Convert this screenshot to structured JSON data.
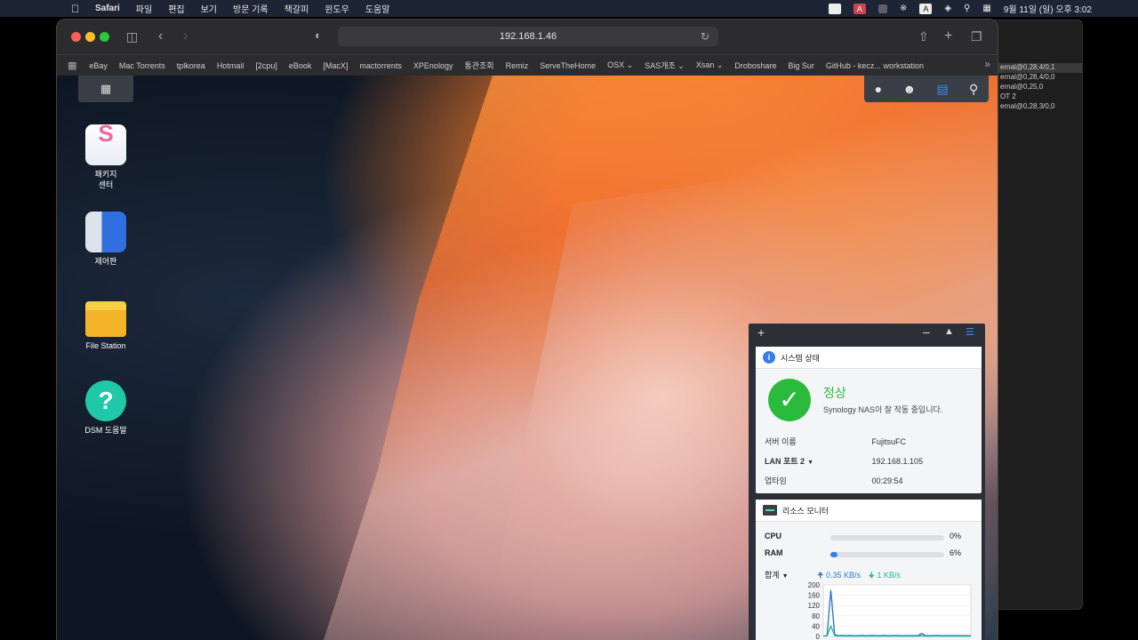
{
  "menubar": {
    "apple": "",
    "app": "Safari",
    "items": [
      "파일",
      "편집",
      "보기",
      "방문 기록",
      "책갈피",
      "윈도우",
      "도움말"
    ],
    "tray_a": "A",
    "tray_a2": "A",
    "clock": "9월 11일 (일) 오후 3:02"
  },
  "background_window": {
    "rows": [
      "ernal@0,28,4/0,1",
      "ernal@0,28,4/0,0",
      "ernal@0,25,0",
      "OT 2",
      "ernal@0,28,3/0,0"
    ]
  },
  "safari": {
    "address": "192.168.1.46",
    "favorites": [
      "eBay",
      "Mac Torrents",
      "tplkorea",
      "Hotmail",
      "[2cpu]",
      "eBook",
      "[MacX]",
      "mactorrents",
      "XPEnology",
      "통관조회",
      "Remiz",
      "ServeTheHome",
      "OSX ⌄",
      "SAS개조 ⌄",
      "Xsan ⌄",
      "Droboshare",
      "Big Sur",
      "GitHub - kecz... workstation"
    ]
  },
  "desktop": {
    "icons": [
      {
        "label": "패키지\n센터"
      },
      {
        "label": "제어판"
      },
      {
        "label": "File Station"
      },
      {
        "label": "DSM 도움말"
      }
    ],
    "help_glyph": "?"
  },
  "widget": {
    "system": {
      "title": "시스템 상태",
      "status": "정상",
      "desc": "Synology NAS이 잘 작동 중입니다.",
      "server_label": "서버 이름",
      "server_value": "FujitsuFC",
      "lan_label": "LAN 포트 2",
      "lan_value": "192.168.1.105",
      "uptime_label": "업타임",
      "uptime_value": "00:29:54"
    },
    "resource": {
      "title": "리소스 모니터",
      "cpu_label": "CPU",
      "cpu_pct": "0%",
      "cpu_value": 0,
      "ram_label": "RAM",
      "ram_pct": "6%",
      "ram_value": 6,
      "total_label": "합계",
      "up": "0.35 KB/s",
      "down": "1 KB/s"
    }
  },
  "chart_data": {
    "type": "line",
    "ylim": [
      0,
      200
    ],
    "yticks": [
      200,
      160,
      120,
      80,
      40,
      0
    ],
    "x": [
      0,
      1,
      2,
      3,
      4,
      5,
      6,
      7,
      8,
      9,
      10,
      11,
      12,
      13,
      14,
      15,
      16,
      17,
      18,
      19,
      20,
      21,
      22,
      23,
      24,
      25,
      26,
      27,
      28,
      29,
      30,
      31,
      32,
      33,
      34,
      35,
      36,
      37,
      38,
      39
    ],
    "series": [
      {
        "values": [
          2,
          3,
          180,
          8,
          3,
          4,
          3,
          4,
          3,
          3,
          4,
          3,
          3,
          4,
          3,
          3,
          4,
          3,
          3,
          4,
          3,
          3,
          3,
          3,
          3,
          3,
          12,
          4,
          3,
          3,
          4,
          3,
          3,
          3,
          3,
          3,
          3,
          3,
          3,
          3
        ]
      },
      {
        "values": [
          1,
          2,
          40,
          4,
          1,
          2,
          1,
          2,
          1,
          1,
          2,
          1,
          1,
          2,
          1,
          1,
          2,
          1,
          1,
          2,
          1,
          1,
          1,
          1,
          1,
          1,
          3,
          1,
          1,
          1,
          2,
          1,
          1,
          1,
          1,
          1,
          1,
          1,
          1,
          1
        ]
      }
    ],
    "colors": [
      "#2f79d6",
      "#2bb39a"
    ]
  }
}
